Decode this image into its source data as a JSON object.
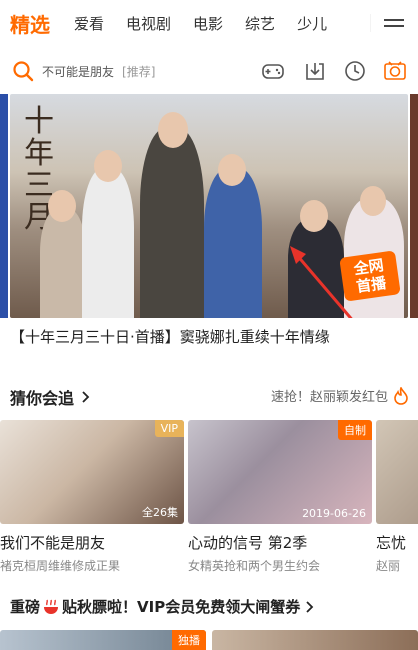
{
  "tabs": {
    "items": [
      {
        "label": "精选",
        "active": true
      },
      {
        "label": "爱看",
        "active": false
      },
      {
        "label": "电视剧",
        "active": false
      },
      {
        "label": "电影",
        "active": false
      },
      {
        "label": "综艺",
        "active": false
      },
      {
        "label": "少儿",
        "active": false
      }
    ],
    "more_icon": "menu-icon"
  },
  "search": {
    "text": "不可能是朋友",
    "hint": "[推荐]",
    "icon": "search-icon"
  },
  "toolbar": {
    "icons": [
      "gamepad-icon",
      "download-icon",
      "history-icon",
      "vip-coin-icon"
    ]
  },
  "banner": {
    "poster_title": "十年三月",
    "stamp": "全网首播",
    "caption": "【十年三月三十日·首播】窦骁娜扎重续十年情缘"
  },
  "guess": {
    "title": "猜你会追",
    "promo": "速抢！赵丽颖发红包"
  },
  "cards": [
    {
      "badge": "VIP",
      "meta": "全26集",
      "title": "我们不能是朋友",
      "sub": "褚克桓周维维修成正果"
    },
    {
      "badge": "自制",
      "meta": "2019-06-26",
      "title": "心动的信号 第2季",
      "sub": "女精英抢和两个男生约会"
    },
    {
      "badge": "",
      "meta": "",
      "title": "忘忧",
      "sub": "赵丽"
    }
  ],
  "vip_banner": {
    "text_before": "重磅",
    "text_after": "贴秋膘啦！VIP会员免费领大闸蟹券"
  },
  "bottom": {
    "badge": "独播"
  },
  "colors": {
    "accent": "#ff6a00",
    "vip_gold": "#e8b35a"
  }
}
